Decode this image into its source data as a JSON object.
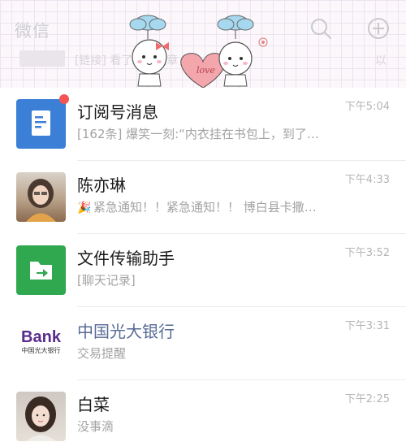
{
  "header": {
    "app_title": "微信",
    "faded_row": {
      "left_text": "[链接] 看了你的文章，我……",
      "right_text": "以"
    }
  },
  "chats": [
    {
      "name": "订阅号消息",
      "preview": "[162条] 爆笑一刻:“内衣挂在书包上，到了…",
      "time": "下午5:04",
      "avatar_icon": "subscription-doc-icon",
      "has_badge": true
    },
    {
      "name": "陈亦琳",
      "preview": "紧急通知！！紧急通知！！ 博白县卡撒…",
      "preview_emoji": "🎉",
      "time": "下午4:33",
      "avatar_icon": "contact-photo"
    },
    {
      "name": "文件传输助手",
      "preview": "[聊天记录]",
      "time": "下午3:52",
      "avatar_icon": "file-transfer-icon"
    },
    {
      "name": "中国光大银行",
      "preview": "交易提醒",
      "time": "下午3:31",
      "avatar_icon": "bank-logo",
      "avatar_text": {
        "top": "Bank",
        "bottom": "中国光大银行"
      }
    },
    {
      "name": "白菜",
      "preview": "没事滴",
      "time": "下午2:25",
      "avatar_icon": "contact-photo"
    }
  ],
  "colors": {
    "subscription": "#3b7fd6",
    "file_transfer": "#2fa84f",
    "bank_purple": "#5a2d8c",
    "official_name": "#576b95",
    "badge": "#f45454"
  }
}
